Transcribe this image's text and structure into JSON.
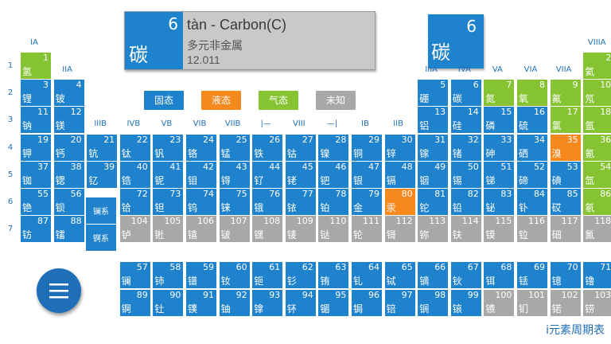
{
  "detail": {
    "number": "6",
    "symbol": "碳",
    "title": "tàn - Carbon(C)",
    "category": "多元非金属",
    "mass": "12.011"
  },
  "preview": {
    "number": "6",
    "symbol": "碳"
  },
  "legend": [
    {
      "label": "固态",
      "color": "#1f82cc"
    },
    {
      "label": "液态",
      "color": "#f6891e"
    },
    {
      "label": "气态",
      "color": "#86c332"
    },
    {
      "label": "未知",
      "color": "#a8a8a8"
    }
  ],
  "group_labels": [
    {
      "text": "IA",
      "col": 1,
      "row": 0.35
    },
    {
      "text": "IIA",
      "col": 2,
      "row": 1.35
    },
    {
      "text": "IIIB",
      "col": 3,
      "row": 3.35
    },
    {
      "text": "IVB",
      "col": 4,
      "row": 3.35
    },
    {
      "text": "VB",
      "col": 5,
      "row": 3.35
    },
    {
      "text": "VIB",
      "col": 6,
      "row": 3.35
    },
    {
      "text": "VIIB",
      "col": 7,
      "row": 3.35
    },
    {
      "text": "|—",
      "col": 8,
      "row": 3.35
    },
    {
      "text": "VIII",
      "col": 9,
      "row": 3.35
    },
    {
      "text": "—|",
      "col": 10,
      "row": 3.35
    },
    {
      "text": "IB",
      "col": 11,
      "row": 3.35
    },
    {
      "text": "IIB",
      "col": 12,
      "row": 3.35
    },
    {
      "text": "IIIA",
      "col": 13,
      "row": 1.35
    },
    {
      "text": "IVA",
      "col": 14,
      "row": 1.35
    },
    {
      "text": "VA",
      "col": 15,
      "row": 1.35
    },
    {
      "text": "VIA",
      "col": 16,
      "row": 1.35
    },
    {
      "text": "VIIA",
      "col": 17,
      "row": 1.35
    },
    {
      "text": "VIIIA",
      "col": 18,
      "row": 0.35
    }
  ],
  "period_labels": [
    "1",
    "2",
    "3",
    "4",
    "5",
    "6",
    "7"
  ],
  "series_labels": {
    "lanthanide": "镧系",
    "actinide": "锕系"
  },
  "elements": [
    {
      "n": "1",
      "s": "氢",
      "col": 1,
      "row": 1,
      "st": "gas"
    },
    {
      "n": "2",
      "s": "氦",
      "col": 18,
      "row": 1,
      "st": "gas"
    },
    {
      "n": "3",
      "s": "锂",
      "col": 1,
      "row": 2,
      "st": "solid"
    },
    {
      "n": "4",
      "s": "铍",
      "col": 2,
      "row": 2,
      "st": "solid"
    },
    {
      "n": "5",
      "s": "硼",
      "col": 13,
      "row": 2,
      "st": "solid"
    },
    {
      "n": "6",
      "s": "碳",
      "col": 14,
      "row": 2,
      "st": "solid"
    },
    {
      "n": "7",
      "s": "氮",
      "col": 15,
      "row": 2,
      "st": "gas"
    },
    {
      "n": "8",
      "s": "氧",
      "col": 16,
      "row": 2,
      "st": "gas"
    },
    {
      "n": "9",
      "s": "氟",
      "col": 17,
      "row": 2,
      "st": "gas"
    },
    {
      "n": "10",
      "s": "氖",
      "col": 18,
      "row": 2,
      "st": "gas"
    },
    {
      "n": "11",
      "s": "钠",
      "col": 1,
      "row": 3,
      "st": "solid"
    },
    {
      "n": "12",
      "s": "镁",
      "col": 2,
      "row": 3,
      "st": "solid"
    },
    {
      "n": "13",
      "s": "铝",
      "col": 13,
      "row": 3,
      "st": "solid"
    },
    {
      "n": "14",
      "s": "硅",
      "col": 14,
      "row": 3,
      "st": "solid"
    },
    {
      "n": "15",
      "s": "磷",
      "col": 15,
      "row": 3,
      "st": "solid"
    },
    {
      "n": "16",
      "s": "硫",
      "col": 16,
      "row": 3,
      "st": "solid"
    },
    {
      "n": "17",
      "s": "氯",
      "col": 17,
      "row": 3,
      "st": "gas"
    },
    {
      "n": "18",
      "s": "氩",
      "col": 18,
      "row": 3,
      "st": "gas"
    },
    {
      "n": "19",
      "s": "钾",
      "col": 1,
      "row": 4,
      "st": "solid"
    },
    {
      "n": "20",
      "s": "钙",
      "col": 2,
      "row": 4,
      "st": "solid"
    },
    {
      "n": "21",
      "s": "钪",
      "col": 3,
      "row": 4,
      "st": "solid"
    },
    {
      "n": "22",
      "s": "钛",
      "col": 4,
      "row": 4,
      "st": "solid"
    },
    {
      "n": "23",
      "s": "钒",
      "col": 5,
      "row": 4,
      "st": "solid"
    },
    {
      "n": "24",
      "s": "铬",
      "col": 6,
      "row": 4,
      "st": "solid"
    },
    {
      "n": "25",
      "s": "锰",
      "col": 7,
      "row": 4,
      "st": "solid"
    },
    {
      "n": "26",
      "s": "铁",
      "col": 8,
      "row": 4,
      "st": "solid"
    },
    {
      "n": "27",
      "s": "钴",
      "col": 9,
      "row": 4,
      "st": "solid"
    },
    {
      "n": "28",
      "s": "镍",
      "col": 10,
      "row": 4,
      "st": "solid"
    },
    {
      "n": "29",
      "s": "铜",
      "col": 11,
      "row": 4,
      "st": "solid"
    },
    {
      "n": "30",
      "s": "锌",
      "col": 12,
      "row": 4,
      "st": "solid"
    },
    {
      "n": "31",
      "s": "镓",
      "col": 13,
      "row": 4,
      "st": "solid"
    },
    {
      "n": "32",
      "s": "锗",
      "col": 14,
      "row": 4,
      "st": "solid"
    },
    {
      "n": "33",
      "s": "砷",
      "col": 15,
      "row": 4,
      "st": "solid"
    },
    {
      "n": "34",
      "s": "硒",
      "col": 16,
      "row": 4,
      "st": "solid"
    },
    {
      "n": "35",
      "s": "溴",
      "col": 17,
      "row": 4,
      "st": "liquid"
    },
    {
      "n": "36",
      "s": "氪",
      "col": 18,
      "row": 4,
      "st": "gas"
    },
    {
      "n": "37",
      "s": "铷",
      "col": 1,
      "row": 5,
      "st": "solid"
    },
    {
      "n": "38",
      "s": "锶",
      "col": 2,
      "row": 5,
      "st": "solid"
    },
    {
      "n": "39",
      "s": "钇",
      "col": 3,
      "row": 5,
      "st": "solid"
    },
    {
      "n": "40",
      "s": "锆",
      "col": 4,
      "row": 5,
      "st": "solid"
    },
    {
      "n": "41",
      "s": "铌",
      "col": 5,
      "row": 5,
      "st": "solid"
    },
    {
      "n": "42",
      "s": "钼",
      "col": 6,
      "row": 5,
      "st": "solid"
    },
    {
      "n": "43",
      "s": "锝",
      "col": 7,
      "row": 5,
      "st": "solid"
    },
    {
      "n": "44",
      "s": "钌",
      "col": 8,
      "row": 5,
      "st": "solid"
    },
    {
      "n": "45",
      "s": "铑",
      "col": 9,
      "row": 5,
      "st": "solid"
    },
    {
      "n": "46",
      "s": "钯",
      "col": 10,
      "row": 5,
      "st": "solid"
    },
    {
      "n": "47",
      "s": "银",
      "col": 11,
      "row": 5,
      "st": "solid"
    },
    {
      "n": "48",
      "s": "镉",
      "col": 12,
      "row": 5,
      "st": "solid"
    },
    {
      "n": "49",
      "s": "铟",
      "col": 13,
      "row": 5,
      "st": "solid"
    },
    {
      "n": "50",
      "s": "锡",
      "col": 14,
      "row": 5,
      "st": "solid"
    },
    {
      "n": "51",
      "s": "锑",
      "col": 15,
      "row": 5,
      "st": "solid"
    },
    {
      "n": "52",
      "s": "碲",
      "col": 16,
      "row": 5,
      "st": "solid"
    },
    {
      "n": "53",
      "s": "碘",
      "col": 17,
      "row": 5,
      "st": "solid"
    },
    {
      "n": "54",
      "s": "氙",
      "col": 18,
      "row": 5,
      "st": "gas"
    },
    {
      "n": "55",
      "s": "铯",
      "col": 1,
      "row": 6,
      "st": "solid"
    },
    {
      "n": "56",
      "s": "钡",
      "col": 2,
      "row": 6,
      "st": "solid"
    },
    {
      "n": "72",
      "s": "铪",
      "col": 4,
      "row": 6,
      "st": "solid"
    },
    {
      "n": "73",
      "s": "钽",
      "col": 5,
      "row": 6,
      "st": "solid"
    },
    {
      "n": "74",
      "s": "钨",
      "col": 6,
      "row": 6,
      "st": "solid"
    },
    {
      "n": "75",
      "s": "铼",
      "col": 7,
      "row": 6,
      "st": "solid"
    },
    {
      "n": "76",
      "s": "锇",
      "col": 8,
      "row": 6,
      "st": "solid"
    },
    {
      "n": "77",
      "s": "铱",
      "col": 9,
      "row": 6,
      "st": "solid"
    },
    {
      "n": "78",
      "s": "铂",
      "col": 10,
      "row": 6,
      "st": "solid"
    },
    {
      "n": "79",
      "s": "金",
      "col": 11,
      "row": 6,
      "st": "solid"
    },
    {
      "n": "80",
      "s": "汞",
      "col": 12,
      "row": 6,
      "st": "liquid"
    },
    {
      "n": "81",
      "s": "铊",
      "col": 13,
      "row": 6,
      "st": "solid"
    },
    {
      "n": "82",
      "s": "铅",
      "col": 14,
      "row": 6,
      "st": "solid"
    },
    {
      "n": "83",
      "s": "铋",
      "col": 15,
      "row": 6,
      "st": "solid"
    },
    {
      "n": "84",
      "s": "钋",
      "col": 16,
      "row": 6,
      "st": "solid"
    },
    {
      "n": "85",
      "s": "砹",
      "col": 17,
      "row": 6,
      "st": "solid"
    },
    {
      "n": "86",
      "s": "氡",
      "col": 18,
      "row": 6,
      "st": "gas"
    },
    {
      "n": "87",
      "s": "钫",
      "col": 1,
      "row": 7,
      "st": "solid"
    },
    {
      "n": "88",
      "s": "镭",
      "col": 2,
      "row": 7,
      "st": "solid"
    },
    {
      "n": "104",
      "s": "𬬻",
      "col": 4,
      "row": 7,
      "st": "unknown"
    },
    {
      "n": "105",
      "s": "𬭊",
      "col": 5,
      "row": 7,
      "st": "unknown"
    },
    {
      "n": "106",
      "s": "𬭳",
      "col": 6,
      "row": 7,
      "st": "unknown"
    },
    {
      "n": "107",
      "s": "𬭛",
      "col": 7,
      "row": 7,
      "st": "unknown"
    },
    {
      "n": "108",
      "s": "𬭶",
      "col": 8,
      "row": 7,
      "st": "unknown"
    },
    {
      "n": "109",
      "s": "鿏",
      "col": 9,
      "row": 7,
      "st": "unknown"
    },
    {
      "n": "110",
      "s": "𫟼",
      "col": 10,
      "row": 7,
      "st": "unknown"
    },
    {
      "n": "111",
      "s": "𬬭",
      "col": 11,
      "row": 7,
      "st": "unknown"
    },
    {
      "n": "112",
      "s": "鿔",
      "col": 12,
      "row": 7,
      "st": "unknown"
    },
    {
      "n": "113",
      "s": "鿭",
      "col": 13,
      "row": 7,
      "st": "unknown"
    },
    {
      "n": "114",
      "s": "𫓧",
      "col": 14,
      "row": 7,
      "st": "unknown"
    },
    {
      "n": "115",
      "s": "镆",
      "col": 15,
      "row": 7,
      "st": "unknown"
    },
    {
      "n": "116",
      "s": "𫟷",
      "col": 16,
      "row": 7,
      "st": "unknown"
    },
    {
      "n": "117",
      "s": "鿬",
      "col": 17,
      "row": 7,
      "st": "unknown"
    },
    {
      "n": "118",
      "s": "鿫",
      "col": 18,
      "row": 7,
      "st": "unknown"
    },
    {
      "n": "57",
      "s": "镧",
      "col": 4,
      "row": 9,
      "st": "solid"
    },
    {
      "n": "58",
      "s": "铈",
      "col": 5,
      "row": 9,
      "st": "solid"
    },
    {
      "n": "59",
      "s": "镨",
      "col": 6,
      "row": 9,
      "st": "solid"
    },
    {
      "n": "60",
      "s": "钕",
      "col": 7,
      "row": 9,
      "st": "solid"
    },
    {
      "n": "61",
      "s": "钷",
      "col": 8,
      "row": 9,
      "st": "solid"
    },
    {
      "n": "62",
      "s": "钐",
      "col": 9,
      "row": 9,
      "st": "solid"
    },
    {
      "n": "63",
      "s": "铕",
      "col": 10,
      "row": 9,
      "st": "solid"
    },
    {
      "n": "64",
      "s": "钆",
      "col": 11,
      "row": 9,
      "st": "solid"
    },
    {
      "n": "65",
      "s": "铽",
      "col": 12,
      "row": 9,
      "st": "solid"
    },
    {
      "n": "66",
      "s": "镝",
      "col": 13,
      "row": 9,
      "st": "solid"
    },
    {
      "n": "67",
      "s": "钬",
      "col": 14,
      "row": 9,
      "st": "solid"
    },
    {
      "n": "68",
      "s": "铒",
      "col": 15,
      "row": 9,
      "st": "solid"
    },
    {
      "n": "69",
      "s": "铥",
      "col": 16,
      "row": 9,
      "st": "solid"
    },
    {
      "n": "70",
      "s": "镱",
      "col": 17,
      "row": 9,
      "st": "solid"
    },
    {
      "n": "71",
      "s": "镥",
      "col": 18,
      "row": 9,
      "st": "solid"
    },
    {
      "n": "89",
      "s": "锕",
      "col": 4,
      "row": 10,
      "st": "solid"
    },
    {
      "n": "90",
      "s": "钍",
      "col": 5,
      "row": 10,
      "st": "solid"
    },
    {
      "n": "91",
      "s": "镤",
      "col": 6,
      "row": 10,
      "st": "solid"
    },
    {
      "n": "92",
      "s": "铀",
      "col": 7,
      "row": 10,
      "st": "solid"
    },
    {
      "n": "93",
      "s": "镎",
      "col": 8,
      "row": 10,
      "st": "solid"
    },
    {
      "n": "94",
      "s": "钚",
      "col": 9,
      "row": 10,
      "st": "solid"
    },
    {
      "n": "95",
      "s": "镅",
      "col": 10,
      "row": 10,
      "st": "solid"
    },
    {
      "n": "96",
      "s": "锔",
      "col": 11,
      "row": 10,
      "st": "solid"
    },
    {
      "n": "97",
      "s": "锫",
      "col": 12,
      "row": 10,
      "st": "solid"
    },
    {
      "n": "98",
      "s": "锎",
      "col": 13,
      "row": 10,
      "st": "solid"
    },
    {
      "n": "99",
      "s": "锿",
      "col": 14,
      "row": 10,
      "st": "solid"
    },
    {
      "n": "100",
      "s": "镄",
      "col": 15,
      "row": 10,
      "st": "unknown"
    },
    {
      "n": "101",
      "s": "钔",
      "col": 16,
      "row": 10,
      "st": "unknown"
    },
    {
      "n": "102",
      "s": "锘",
      "col": 17,
      "row": 10,
      "st": "unknown"
    },
    {
      "n": "103",
      "s": "铹",
      "col": 18,
      "row": 10,
      "st": "unknown"
    }
  ],
  "state_colors": {
    "solid": "#1f82cc",
    "liquid": "#f6891e",
    "gas": "#86c332",
    "unknown": "#a8a8a8"
  },
  "menu_icon": "hamburger-menu-icon",
  "app_name": "i元素周期表"
}
